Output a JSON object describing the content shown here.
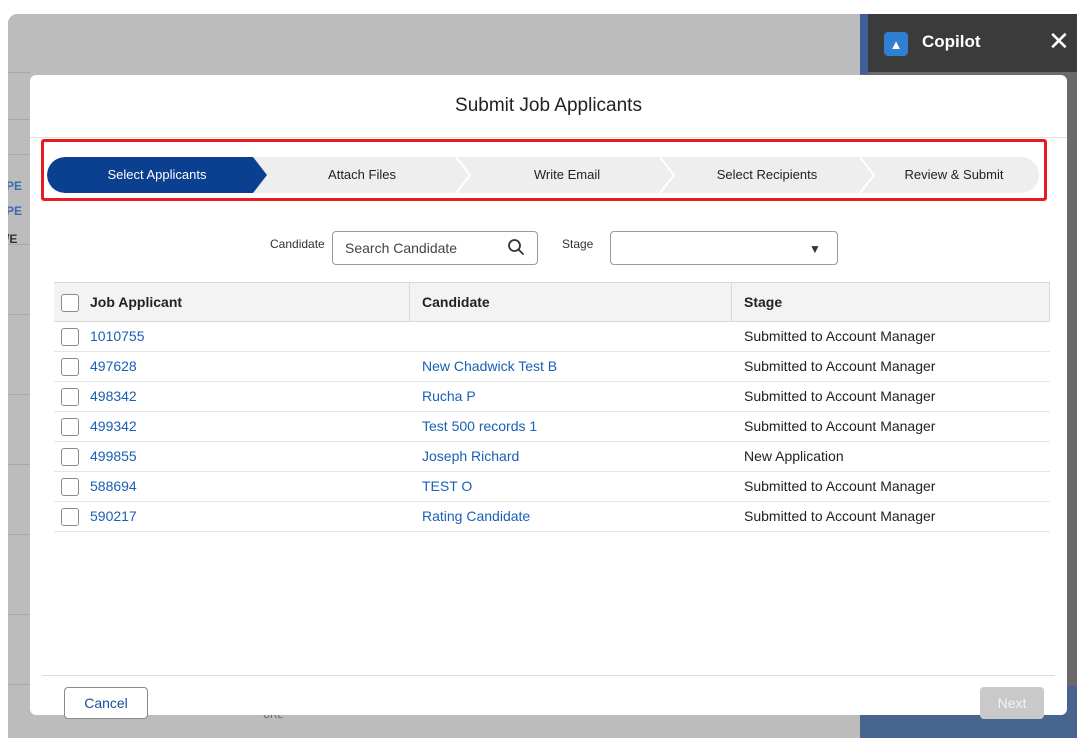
{
  "copilot": {
    "title": "Copilot",
    "close_glyph": "✕"
  },
  "background": {
    "stubs": [
      "PE",
      "PE",
      "/E"
    ],
    "bottom_text": "URL"
  },
  "modal": {
    "title": "Submit Job Applicants",
    "steps": [
      {
        "label": "Select Applicants",
        "active": true
      },
      {
        "label": "Attach Files",
        "active": false
      },
      {
        "label": "Write Email",
        "active": false
      },
      {
        "label": "Select Recipients",
        "active": false
      },
      {
        "label": "Review & Submit",
        "active": false
      }
    ],
    "filters": {
      "candidate_label": "Candidate",
      "candidate_placeholder": "Search Candidate",
      "stage_label": "Stage",
      "stage_value": ""
    },
    "table": {
      "columns": [
        "Job Applicant",
        "Candidate",
        "Stage"
      ],
      "rows": [
        {
          "job_applicant": "1010755",
          "candidate": "",
          "stage": "Submitted to Account Manager"
        },
        {
          "job_applicant": "497628",
          "candidate": "New Chadwick Test B",
          "stage": "Submitted to Account Manager"
        },
        {
          "job_applicant": "498342",
          "candidate": "Rucha P",
          "stage": "Submitted to Account Manager"
        },
        {
          "job_applicant": "499342",
          "candidate": "Test 500 records 1",
          "stage": "Submitted to Account Manager"
        },
        {
          "job_applicant": "499855",
          "candidate": "Joseph Richard",
          "stage": "New Application"
        },
        {
          "job_applicant": "588694",
          "candidate": "TEST O",
          "stage": "Submitted to Account Manager"
        },
        {
          "job_applicant": "590217",
          "candidate": "Rating Candidate",
          "stage": "Submitted to Account Manager"
        }
      ]
    },
    "buttons": {
      "cancel": "Cancel",
      "next": "Next"
    }
  },
  "colors": {
    "accent": "#0b3f8f",
    "highlight_border": "#e51b22",
    "link": "#1a5fb4"
  }
}
